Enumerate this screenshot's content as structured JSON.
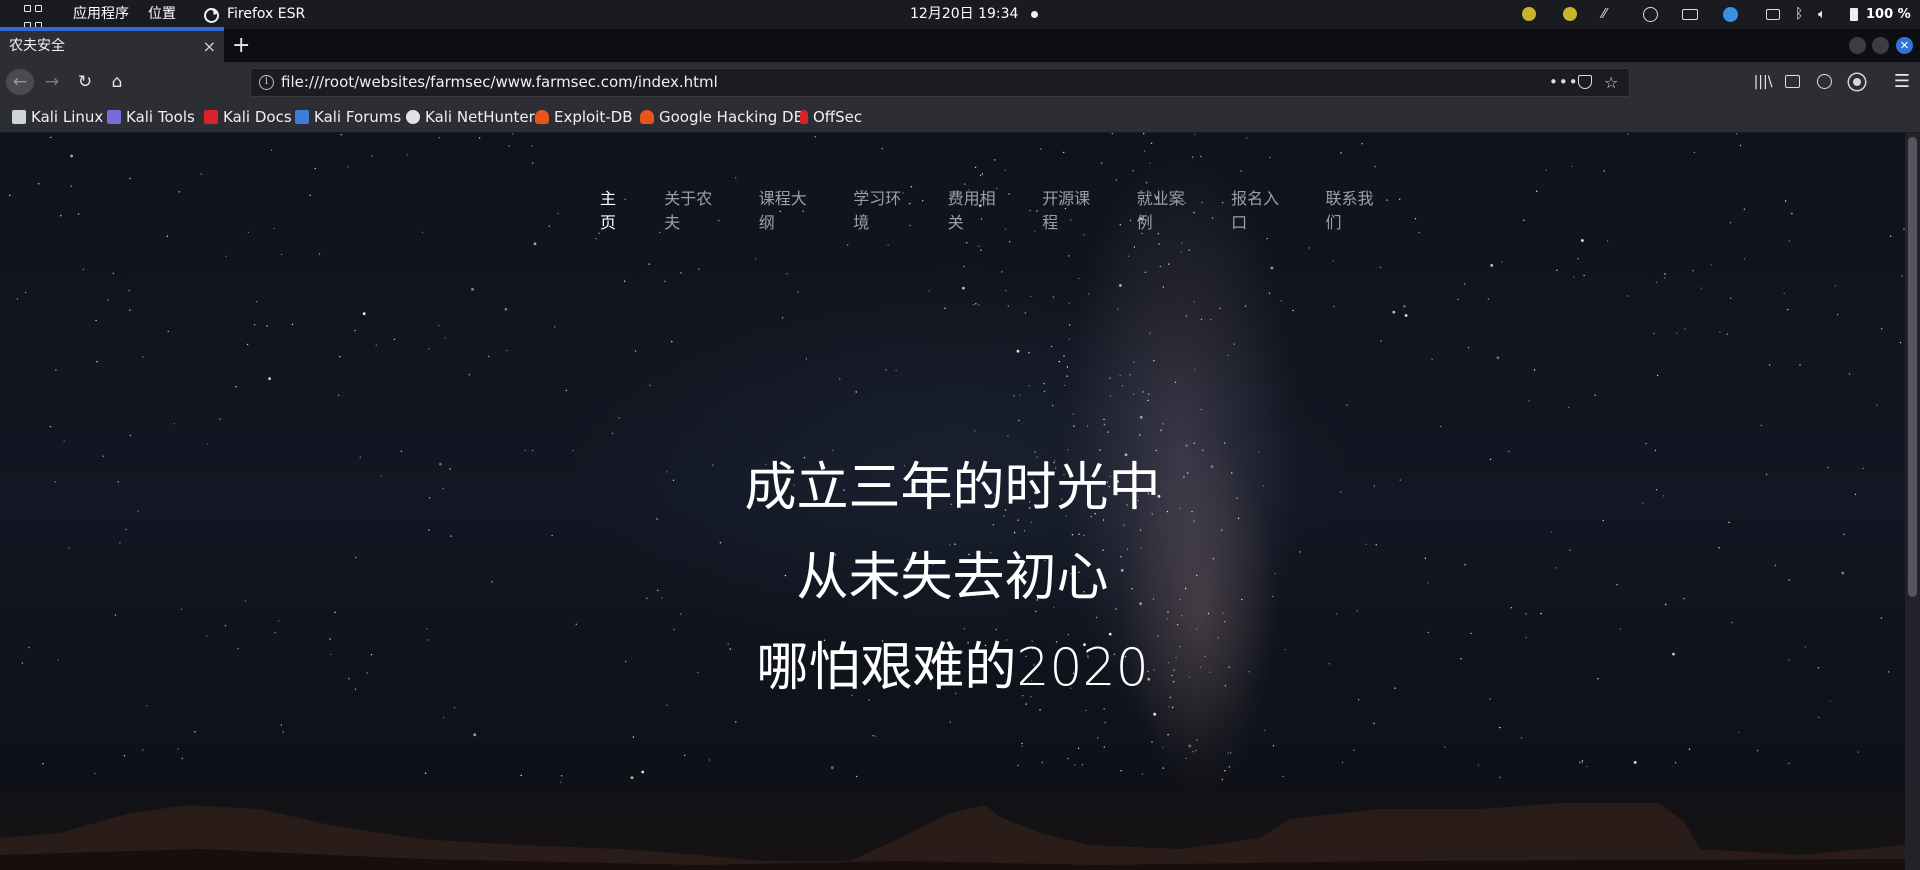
{
  "topbar": {
    "apps_menu": "应用程序",
    "places_menu": "位置",
    "active_app": "Firefox ESR",
    "clock": "12月20日 19:34",
    "battery": "100 %"
  },
  "browser": {
    "tab_title": "农夫安全",
    "new_tab": "+",
    "tab_close": "×",
    "url": "file:///root/websites/farmsec/www.farmsec.com/index.html"
  },
  "bookmarks": [
    {
      "label": "Kali Linux",
      "icon": "kali-dragon-icon",
      "color": "#cfd3da"
    },
    {
      "label": "Kali Tools",
      "icon": "kali-tools-icon",
      "color": "#7a6cd8"
    },
    {
      "label": "Kali Docs",
      "icon": "kali-docs-icon",
      "color": "#d8232a"
    },
    {
      "label": "Kali Forums",
      "icon": "kali-forums-icon",
      "color": "#3d7fd6"
    },
    {
      "label": "Kali NetHunter",
      "icon": "nethunter-icon",
      "color": "#e2e2e2"
    },
    {
      "label": "Exploit-DB",
      "icon": "exploit-db-icon",
      "color": "#e8541c"
    },
    {
      "label": "Google Hacking DB",
      "icon": "ghdb-icon",
      "color": "#e8541c"
    },
    {
      "label": "OffSec",
      "icon": "offsec-icon",
      "color": "#d8232a"
    }
  ],
  "site": {
    "nav": [
      "主页",
      "关于农夫",
      "课程大纲",
      "学习环境",
      "费用相关",
      "开源课程",
      "就业案例",
      "报名入口",
      "联系我们"
    ],
    "hero_lines": [
      "成立三年的时光中",
      "从未失去初心",
      "哪怕艰难的2020"
    ]
  },
  "colors": {
    "accent": "#2e6cd4",
    "toolbar": "#2d2d34",
    "nav_inactive": "#9aa0a8"
  }
}
